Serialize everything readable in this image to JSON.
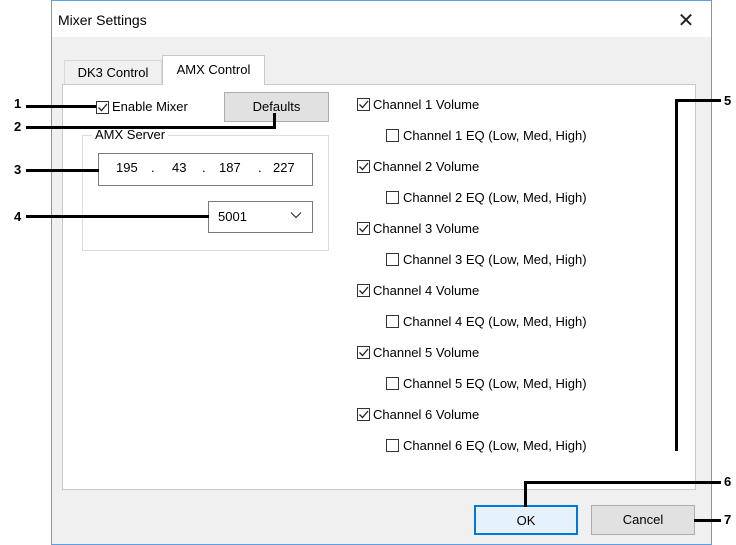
{
  "window": {
    "title": "Mixer Settings",
    "close_glyph": "✕"
  },
  "tabs": [
    {
      "label": "DK3 Control"
    },
    {
      "label": "AMX Control"
    }
  ],
  "enable_mixer": {
    "label": "Enable Mixer",
    "checked": true
  },
  "defaults_button": {
    "label": "Defaults"
  },
  "amx_server": {
    "label": "AMX Server",
    "ip": {
      "o1": "195",
      "o2": "43",
      "o3": "187",
      "o4": "227",
      "dot": "."
    },
    "port": "5001"
  },
  "channels": [
    {
      "volume_label": "Channel 1 Volume",
      "volume_checked": true,
      "eq_label": "Channel 1 EQ (Low, Med, High)",
      "eq_checked": false
    },
    {
      "volume_label": "Channel 2 Volume",
      "volume_checked": true,
      "eq_label": "Channel 2 EQ  (Low, Med, High)",
      "eq_checked": false
    },
    {
      "volume_label": "Channel 3 Volume",
      "volume_checked": true,
      "eq_label": "Channel 3 EQ  (Low, Med, High)",
      "eq_checked": false
    },
    {
      "volume_label": "Channel 4 Volume",
      "volume_checked": true,
      "eq_label": "Channel 4 EQ  (Low, Med, High)",
      "eq_checked": false
    },
    {
      "volume_label": "Channel 5 Volume",
      "volume_checked": true,
      "eq_label": "Channel 5 EQ  (Low, Med, High)",
      "eq_checked": false
    },
    {
      "volume_label": "Channel 6 Volume",
      "volume_checked": true,
      "eq_label": "Channel 6 EQ  (Low, Med, High)",
      "eq_checked": false
    }
  ],
  "buttons": {
    "ok": "OK",
    "cancel": "Cancel"
  },
  "callouts": {
    "n1": "1",
    "n2": "2",
    "n3": "3",
    "n4": "4",
    "n5": "5",
    "n6": "6",
    "n7": "7"
  }
}
